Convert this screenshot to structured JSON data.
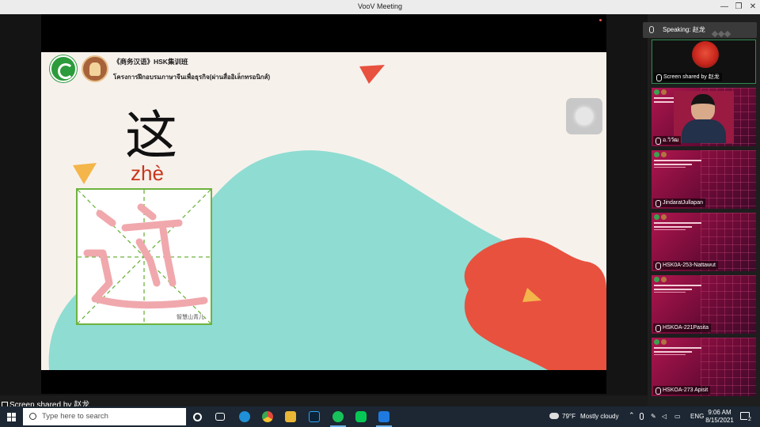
{
  "window": {
    "title": "VooV Meeting",
    "controls": [
      "—",
      "❐",
      "✕"
    ]
  },
  "slide": {
    "course_title": "《商务汉语》HSK集训班",
    "thai_subtitle": "โครงการฝึกอบรมภาษาจีนเพื่อธุรกิจ(ผ่านสื่ออิเล็กทรอนิกส์)",
    "character": "这",
    "pinyin": "zhè",
    "grid_caption": "智慧山青儿",
    "colors": {
      "background": "#f7f1ec",
      "teal": "#8fdcd2",
      "red": "#e8513e",
      "yellow": "#f4b54a",
      "stroke_pink": "#f0a8ad"
    }
  },
  "share_status": {
    "label": "Screen shared by 赵龙"
  },
  "panel": {
    "speaking_label": "Speaking: 赵龙",
    "main_tile_label": "Screen shared by 赵龙",
    "participants": [
      {
        "name": "อ.วิวัฒ",
        "type": "webcam"
      },
      {
        "name": "JindaratJullapan",
        "type": "slide"
      },
      {
        "name": "HSK0A-253-Nattawut",
        "type": "slide"
      },
      {
        "name": "HSKOA-221Pasita",
        "type": "slide"
      },
      {
        "name": "HSKOA-273 Apisit",
        "type": "slide"
      }
    ]
  },
  "taskbar": {
    "search_placeholder": "Type here to search",
    "weather_temp": "79°F",
    "weather_desc": "Mostly cloudy",
    "language": "ENG",
    "time": "9:06 AM",
    "date": "8/15/2021",
    "notification_count": "2"
  }
}
